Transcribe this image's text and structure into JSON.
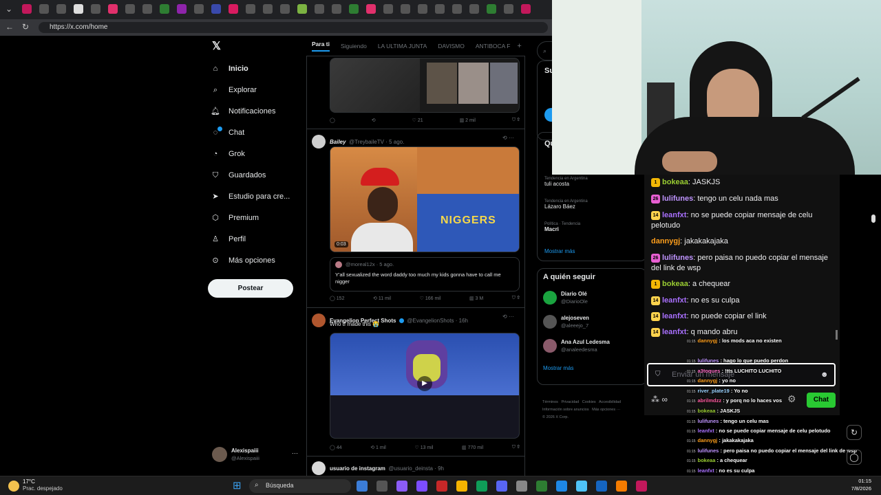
{
  "browser": {
    "url": "https://x.com/home"
  },
  "nav": {
    "items": [
      {
        "label": "Inicio",
        "icon": "home-icon"
      },
      {
        "label": "Explorar",
        "icon": "search-icon"
      },
      {
        "label": "Notificaciones",
        "icon": "bell-icon"
      },
      {
        "label": "Chat",
        "icon": "chat-icon"
      },
      {
        "label": "Grok",
        "icon": "grok-icon"
      },
      {
        "label": "Guardados",
        "icon": "bookmark-icon"
      },
      {
        "label": "Estudio para cre...",
        "icon": "studio-icon"
      },
      {
        "label": "Premium",
        "icon": "premium-icon"
      },
      {
        "label": "Perfil",
        "icon": "person-icon"
      },
      {
        "label": "Más opciones",
        "icon": "more-icon"
      }
    ],
    "post_button": "Postear",
    "account": {
      "name": "Alexispaiii",
      "handle": "@Alexispaiii"
    }
  },
  "feed": {
    "tabs": [
      "Para ti",
      "Siguiendo",
      "LA ULTIMA JUNTA",
      "DAVISMO",
      "ANTIBOCA F"
    ],
    "add_tab": "+",
    "tweet0_actions": {
      "replies": "",
      "retweets": "",
      "likes": "21",
      "views": "2 mil"
    },
    "tweet1": {
      "name": "Bailey",
      "handle": "@TreybaileTV · 5 ago.",
      "video_time": "0:03",
      "video_caption": "NIGGERS",
      "quote_handle": "@moreal12x · 5 ago.",
      "quote_text": "Y'all sexualized the word daddy too much my kids gonna have to call me nigger",
      "actions": {
        "replies": "152",
        "retweets": "11 mil",
        "likes": "166 mil",
        "views": "3 M"
      }
    },
    "tweet2": {
      "name": "Evangelion Perfect Shots",
      "handle": "@EvangelionShots · 16h",
      "text": "Who tf made this",
      "actions": {
        "replies": "44",
        "retweets": "1 mil",
        "likes": "13 mil",
        "views": "770 mil"
      }
    },
    "tweet3": {
      "name": "usuario de instagram",
      "handle": "@usuario_deinsta · 9h"
    }
  },
  "sidebar": {
    "sub_title": "Su",
    "trends_title": "Qu",
    "trends": [
      {
        "context": "Tendencia en Argentina",
        "name": "tuli acosta"
      },
      {
        "context": "Tendencia en Argentina",
        "name": "Lázaro Báez"
      },
      {
        "context": "Política · Tendencia",
        "name": "Macri"
      }
    ],
    "show_more": "Mostrar más",
    "follow_title": "A quién seguir",
    "follow": [
      {
        "name": "Diario Olé",
        "handle": "@DiarioOle"
      },
      {
        "name": "alejoseven",
        "handle": "@aleeejo_7"
      },
      {
        "name": "Ana Azul Ledesma",
        "handle": "@analeedesma"
      }
    ],
    "follow_show_more": "Mostrar más",
    "footer": [
      "Términos",
      "Privacidad",
      "Cookies",
      "Accesibilidad",
      "Información sobre anuncios",
      "Más opciones ···",
      "© 2026 X Corp."
    ]
  },
  "chat": {
    "messages": [
      {
        "badge": "1",
        "badge_color": "#f2b705",
        "user": "bokeaa",
        "user_color": "#9acd32",
        "text": "JASKJS"
      },
      {
        "badge": "26",
        "badge_color": "#e85fd2",
        "user": "lulifunes",
        "user_color": "#bf94ff",
        "text": "tengo un celu nada mas"
      },
      {
        "badge": "14",
        "badge_color": "#ffd34d",
        "user": "leanfxt",
        "user_color": "#a970ff",
        "text": "no se puede copiar mensaje de celu pelotudo"
      },
      {
        "badge": "",
        "badge_color": "",
        "user": "dannygj",
        "user_color": "#ff9f1c",
        "text": "jakakakajaka"
      },
      {
        "badge": "26",
        "badge_color": "#e85fd2",
        "user": "lulifunes",
        "user_color": "#bf94ff",
        "text": "pero paisa no puedo copiar el mensaje del link de wsp"
      },
      {
        "badge": "1",
        "badge_color": "#f2b705",
        "user": "bokeaa",
        "user_color": "#9acd32",
        "text": "a chequear"
      },
      {
        "badge": "14",
        "badge_color": "#ffd34d",
        "user": "leanfxt",
        "user_color": "#a970ff",
        "text": "no es su culpa"
      },
      {
        "badge": "14",
        "badge_color": "#ffd34d",
        "user": "leanfxt",
        "user_color": "#a970ff",
        "text": "no puede copiar el link"
      },
      {
        "badge": "14",
        "badge_color": "#ffd34d",
        "user": "leanfxt",
        "user_color": "#a970ff",
        "text": "q mando abru"
      }
    ],
    "input_placeholder": "Enviar un mensaje",
    "chat_button": "Chat"
  },
  "stream_chat": [
    {
      "time": "01:15",
      "user": "dannygj",
      "text": "los mods aca no existen"
    },
    {
      "time": "01:15",
      "user": "lulifunes",
      "text": "hago lo que puedo perdon"
    },
    {
      "time": "01:15",
      "user": "a3toques",
      "text": "!tts LUCHITO LUCHITO"
    },
    {
      "time": "01:15",
      "user": "dannygj",
      "text": "yo no"
    },
    {
      "time": "01:15",
      "user": "river_plate19",
      "text": "Yo no"
    },
    {
      "time": "01:15",
      "user": "abrilmdzz",
      "text": "y porq no lo haces vos"
    },
    {
      "time": "01:15",
      "user": "bokeaa",
      "text": "JASKJS"
    },
    {
      "time": "01:15",
      "user": "lulifunes",
      "text": "tengo un celu        mas"
    },
    {
      "time": "01:15",
      "user": "leanfxt",
      "text": "no se puede copiar mensaje de celu pelotudo"
    },
    {
      "time": "01:15",
      "user": "dannygj",
      "text": "jakakakajaka"
    },
    {
      "time": "01:15",
      "user": "lulifunes",
      "text": "pero paisa no puedo copiar el mensaje del link de wsp"
    },
    {
      "time": "01:15",
      "user": "bokeaa",
      "text": "a chequear"
    },
    {
      "time": "01:15",
      "user": "leanfxt",
      "text": "no es su culpa"
    },
    {
      "time": "01:15",
      "user": "leanfxt",
      "text": "no puede copiar el link"
    },
    {
      "time": "01:15",
      "user": "leanfxt",
      "text": "q mando abru"
    }
  ],
  "taskbar": {
    "weather_temp": "17°C",
    "weather_desc": "Prac. despejado",
    "search_placeholder": "Búsqueda",
    "time": "01:15",
    "date": "7/8/2026"
  }
}
